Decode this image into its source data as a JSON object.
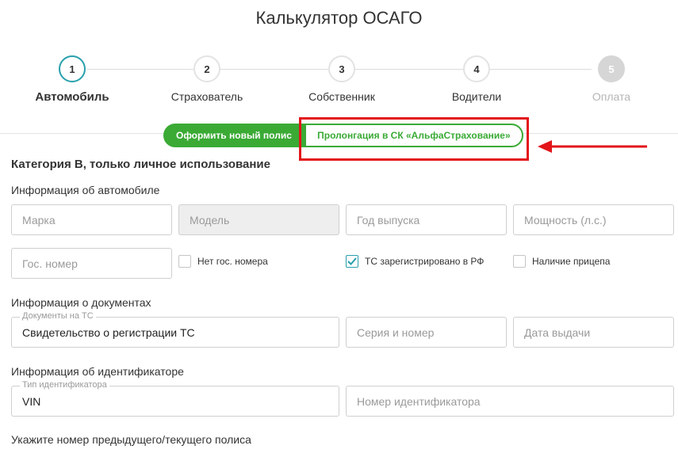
{
  "page": {
    "title": "Калькулятор ОСАГО"
  },
  "steps": [
    {
      "number": "1",
      "label": "Автомобиль",
      "state": "active"
    },
    {
      "number": "2",
      "label": "Страхователь",
      "state": "normal"
    },
    {
      "number": "3",
      "label": "Собственник",
      "state": "normal"
    },
    {
      "number": "4",
      "label": "Водители",
      "state": "normal"
    },
    {
      "number": "5",
      "label": "Оплата",
      "state": "disabled"
    }
  ],
  "toggle": {
    "new_policy": "Оформить новый полис",
    "prolongation": "Пролонгация в СК «АльфаСтрахование»"
  },
  "form": {
    "category_title": "Категория В, только личное использование",
    "car_info_label": "Информация об автомобиле",
    "brand_placeholder": "Марка",
    "model_placeholder": "Модель",
    "year_placeholder": "Год выпуска",
    "power_placeholder": "Мощность (л.с.)",
    "plate_placeholder": "Гос. номер",
    "no_plate_label": "Нет гос. номера",
    "registered_rf_label": "ТС зарегистрировано в РФ",
    "registered_rf_checked": true,
    "trailer_label": "Наличие прицепа",
    "docs_label": "Информация о документах",
    "docs_type_float": "Документы на ТС",
    "docs_type_value": "Свидетельство о регистрации ТС",
    "series_placeholder": "Серия и номер",
    "issue_date_placeholder": "Дата выдачи",
    "identifier_label": "Информация об идентификаторе",
    "identifier_type_float": "Тип идентификатора",
    "identifier_type_value": "VIN",
    "identifier_number_placeholder": "Номер идентификатора",
    "previous_policy_label": "Укажите номер предыдущего/текущего полиса"
  },
  "colors": {
    "accent_green": "#3aaa35",
    "step_active": "#27a0ac",
    "highlight_red": "#e3151a"
  }
}
